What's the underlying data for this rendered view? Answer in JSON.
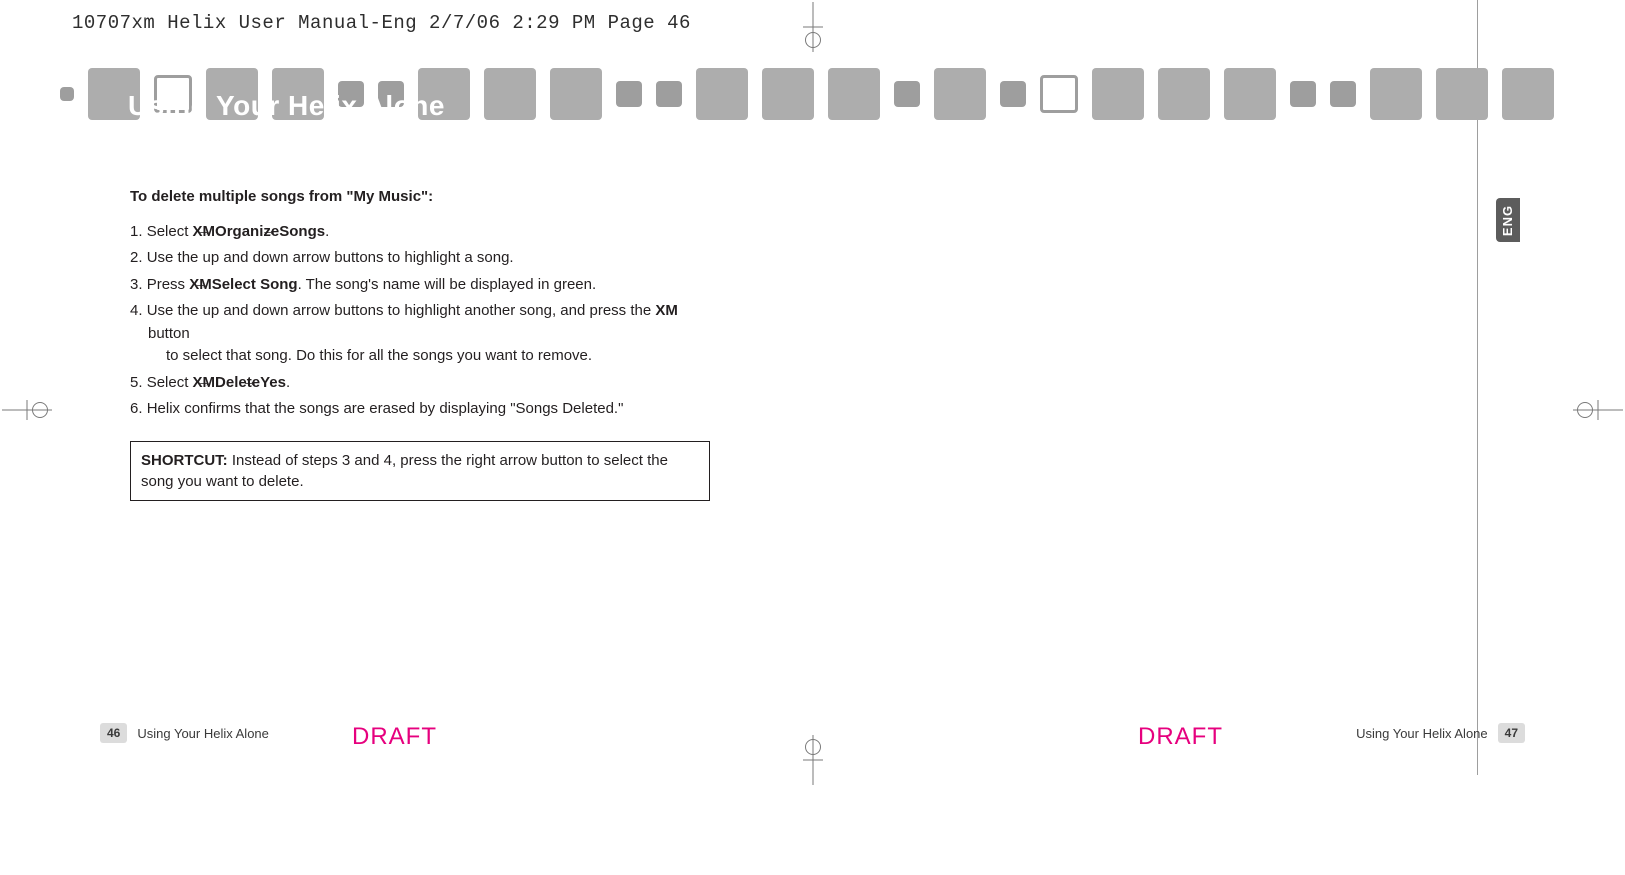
{
  "print_header": "10707xm Helix User Manual-Eng  2/7/06  2:29 PM  Page 46",
  "section_title": "Using Your Helix Alone",
  "side_tab": "ENG",
  "body": {
    "intro": "To delete multiple songs from \"My Music\":",
    "steps": [
      {
        "prefix": "Select ",
        "b1": "XM",
        "sep1": " → ",
        "b2": "Organize",
        "sep2": " → ",
        "b3": "Songs",
        "suffix": "."
      },
      {
        "plain": "Use the up and down arrow buttons to highlight a song."
      },
      {
        "prefix": "Press ",
        "b1": "XM",
        "sep1": " → ",
        "b2": "Select Song",
        "suffix": ". The song's name will be displayed in green."
      },
      {
        "line1_a": "Use the up and down arrow buttons to highlight another song, and press the ",
        "line1_b": "XM",
        "line1_c": " button",
        "line2": "to select that song. Do this for all the songs you want to remove."
      },
      {
        "prefix": "Select ",
        "b1": "XM",
        "sep1": " → ",
        "b2": "Delete",
        "sep2": " → ",
        "b3": "Yes",
        "suffix": "."
      },
      {
        "plain": "Helix confirms that the songs are erased by displaying \"Songs Deleted.\""
      }
    ],
    "shortcut_label": "SHORTCUT:",
    "shortcut_text": " Instead of steps 3 and 4, press the right arrow button to select the song you want to delete."
  },
  "footer": {
    "left_page": "46",
    "left_label": "Using Your Helix Alone",
    "right_label": "Using Your Helix Alone",
    "right_page": "47",
    "draft": "DRAFT"
  }
}
